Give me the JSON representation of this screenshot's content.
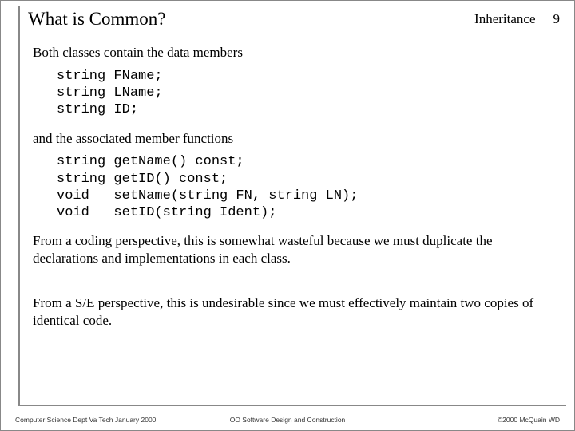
{
  "header": {
    "title": "What is Common?",
    "topic": "Inheritance",
    "page_number": "9"
  },
  "body": {
    "p1": "Both classes contain the data members",
    "code1": "string FName;\nstring LName;\nstring ID;",
    "p2": "and the associated member functions",
    "code2": "string getName() const;\nstring getID() const;\nvoid   setName(string FN, string LN);\nvoid   setID(string Ident);",
    "p3": "From a coding perspective, this is somewhat wasteful because we must duplicate the declarations and implementations in each class.",
    "p4": "From a S/E perspective, this is undesirable since we must effectively maintain two copies of identical code."
  },
  "footer": {
    "left": "Computer Science Dept Va Tech January 2000",
    "center": "OO Software Design and Construction",
    "right": "©2000  McQuain WD"
  }
}
